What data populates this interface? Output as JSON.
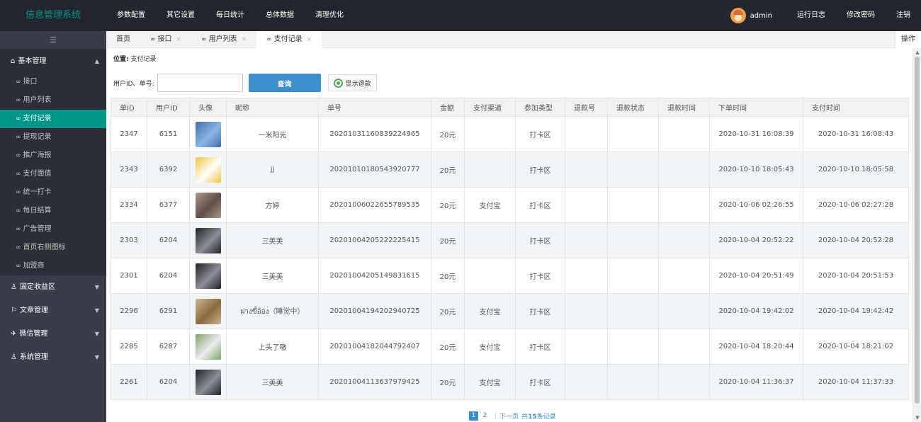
{
  "app": {
    "title": "信息管理系统"
  },
  "topnav": [
    "参数配置",
    "其它设置",
    "每日统计",
    "总体数据",
    "清理优化"
  ],
  "user": {
    "name": "admin",
    "links": [
      "运行日志",
      "修改密码",
      "注销"
    ]
  },
  "sidebar": {
    "toggle_icon": "☰",
    "groups": [
      {
        "label": "基本管理",
        "icon": "⌂",
        "arrow": "▲",
        "items": [
          "接口",
          "用户列表",
          "支付记录",
          "提现记录",
          "推广海报",
          "支付面值",
          "统一打卡",
          "每日结算",
          "广告管理",
          "首页右侧图标",
          "加盟商"
        ]
      },
      {
        "label": "固定收益区",
        "icon": "♙",
        "arrow": "▼"
      },
      {
        "label": "文章管理",
        "icon": "⚐",
        "arrow": "▼"
      },
      {
        "label": "微信管理",
        "icon": "✈",
        "arrow": "▼"
      },
      {
        "label": "系统管理",
        "icon": "♙",
        "arrow": "▼"
      }
    ],
    "link_icon": "∞"
  },
  "tabs": [
    {
      "label": "首页"
    },
    {
      "label": "接口"
    },
    {
      "label": "用户列表"
    },
    {
      "label": "支付记录"
    }
  ],
  "tab_close": "×",
  "ops_label": "操作",
  "breadcrumb": {
    "prefix": "位置:",
    "current": "支付记录"
  },
  "filter": {
    "label": "用户ID、单号:",
    "value": "",
    "search_button": "查询",
    "refund_button": "显示退款"
  },
  "table": {
    "headers": [
      "单ID",
      "用户ID",
      "头像",
      "昵称",
      "单号",
      "金额",
      "支付渠道",
      "参加类型",
      "退款号",
      "退款状态",
      "退款时间",
      "下单时间",
      "支付时间"
    ],
    "rows": [
      [
        "2347",
        "6151",
        "",
        "一米阳光",
        "20201031160839224965",
        "20元",
        "",
        "打卡区",
        "",
        "",
        "",
        "2020-10-31 16:08:39",
        "2020-10-31 16:08:43"
      ],
      [
        "2343",
        "6392",
        "",
        "jj",
        "20201010180543920777",
        "20元",
        "",
        "打卡区",
        "",
        "",
        "",
        "2020-10-10 18:05:43",
        "2020-10-10 18:05:58"
      ],
      [
        "2334",
        "6377",
        "",
        "方婷",
        "20201006022655789535",
        "20元",
        "支付宝",
        "打卡区",
        "",
        "",
        "",
        "2020-10-06 02:26:55",
        "2020-10-06 02:27:28"
      ],
      [
        "2303",
        "6204",
        "",
        "三美美",
        "20201004205222225415",
        "20元",
        "",
        "打卡区",
        "",
        "",
        "",
        "2020-10-04 20:52:22",
        "2020-10-04 20:52:28"
      ],
      [
        "2301",
        "6204",
        "",
        "三美美",
        "20201004205149831615",
        "20元",
        "",
        "打卡区",
        "",
        "",
        "",
        "2020-10-04 20:51:49",
        "2020-10-04 20:51:53"
      ],
      [
        "2296",
        "6291",
        "",
        "ฝางขี้อ้อง（睡觉中）",
        "20201004194202940725",
        "20元",
        "支付宝",
        "打卡区",
        "",
        "",
        "",
        "2020-10-04 19:42:02",
        "2020-10-04 19:42:42"
      ],
      [
        "2285",
        "6287",
        "",
        "上头了嗷",
        "20201004182044792407",
        "20元",
        "支付宝",
        "打卡区",
        "",
        "",
        "",
        "2020-10-04 18:20:44",
        "2020-10-04 18:21:02"
      ],
      [
        "2261",
        "6204",
        "",
        "三美美",
        "20201004113637979425",
        "20元",
        "支付宝",
        "打卡区",
        "",
        "",
        "",
        "2020-10-04 11:36:37",
        "2020-10-04 11:37:33"
      ]
    ],
    "avatar_colors": [
      [
        "#3f6db0",
        "#8cb7e0"
      ],
      [
        "#f2c440",
        "#ffffff"
      ],
      [
        "#a99a88",
        "#5e5048"
      ],
      [
        "#1f2124",
        "#8a8f96"
      ],
      [
        "#1f2124",
        "#8a8f96"
      ],
      [
        "#c9b894",
        "#8a6a3c"
      ],
      [
        "#7aa36a",
        "#ededed"
      ],
      [
        "#1f2124",
        "#8a8f96"
      ]
    ]
  },
  "pagination": {
    "pages": [
      "1",
      "2"
    ],
    "next": "下一页",
    "total_prefix": "共",
    "total_count": "15",
    "total_suffix": "条记录"
  },
  "colors": {
    "accent": "#009688",
    "topbar": "#23262e",
    "sidebar": "#393d49",
    "button": "#3a8fcf"
  }
}
